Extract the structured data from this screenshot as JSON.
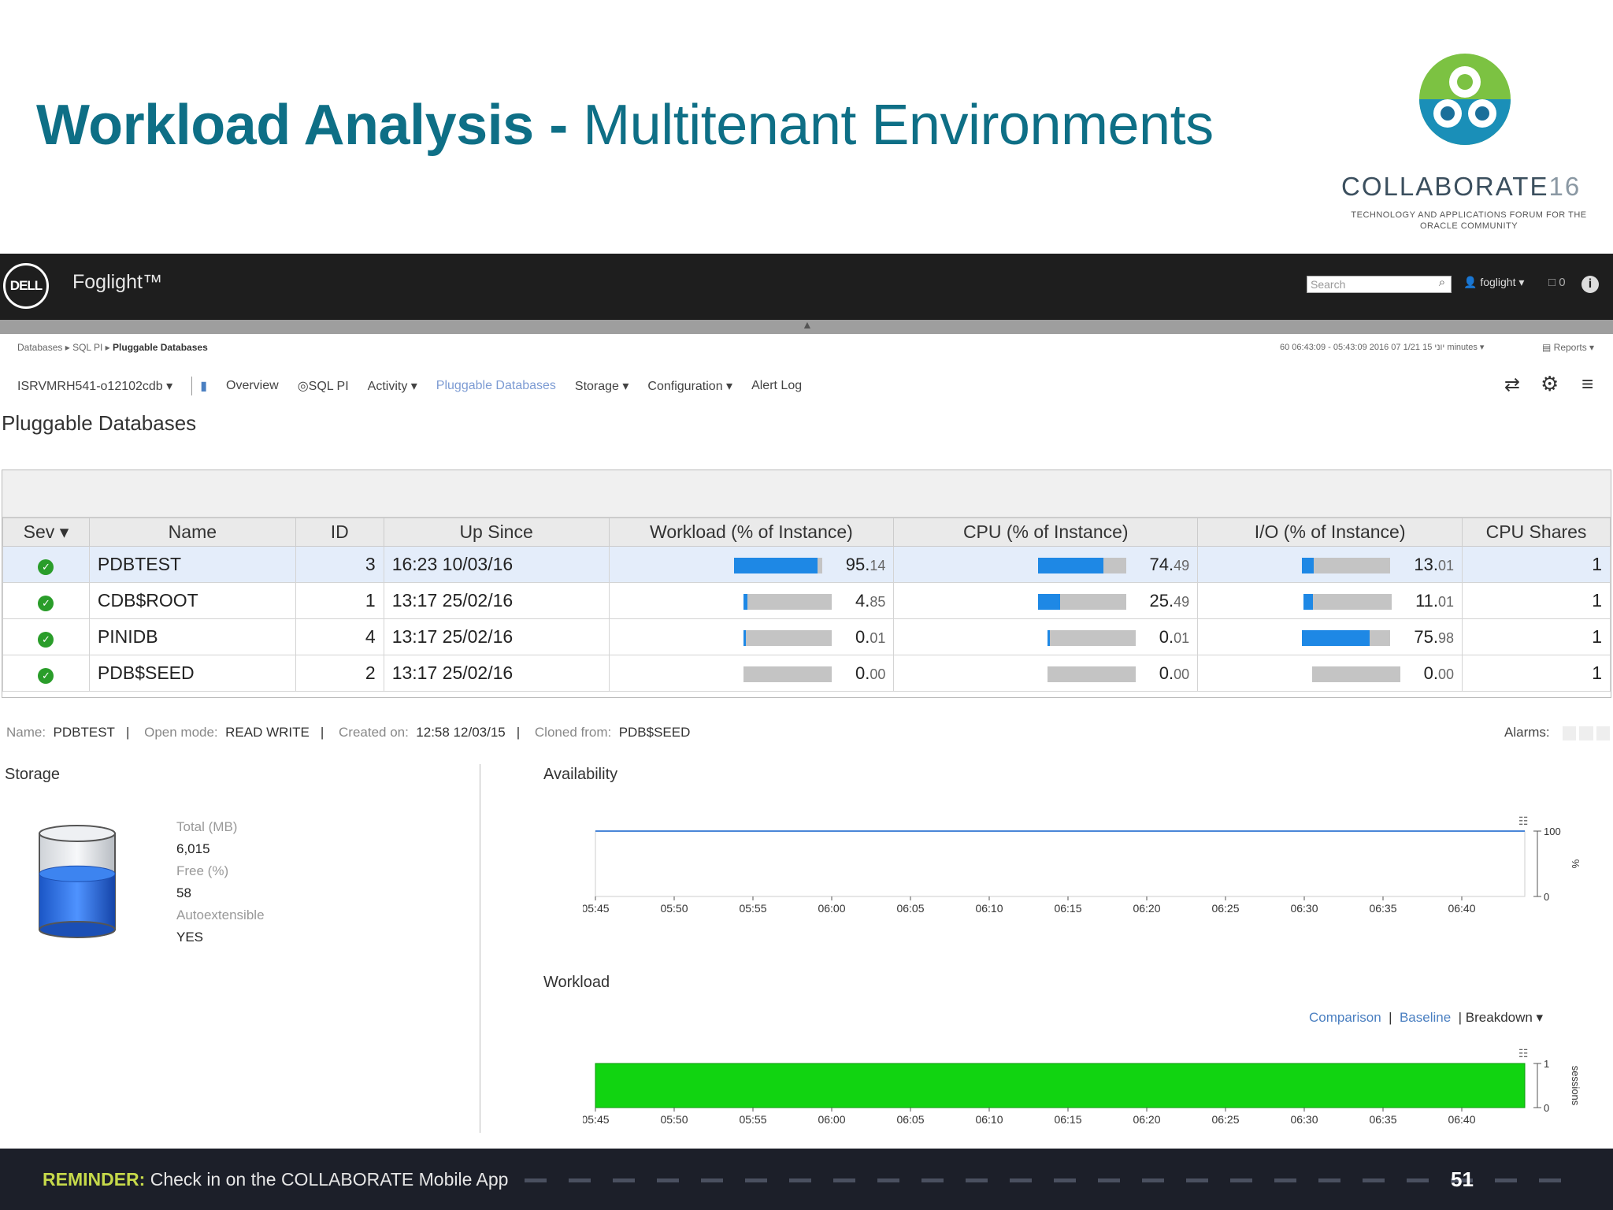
{
  "slide": {
    "title_bold": "Workload Analysis -",
    "title_rest": " Multitenant Environments",
    "logo_word": "COLLABORATE",
    "logo_year": "16",
    "logo_tagline": "TECHNOLOGY AND APPLICATIONS FORUM FOR THE ORACLE COMMUNITY",
    "reminder_label": "REMINDER:",
    "reminder_text": " Check in on the COLLABORATE Mobile App",
    "page_number": "51"
  },
  "app": {
    "vendor_logo": "DELL",
    "name": "Foglight™",
    "search_placeholder": "Search",
    "user": "foglight ▾",
    "chat": "□ 0",
    "info": "i"
  },
  "breadcrumb": {
    "root": "Databases",
    "mid": "SQL PI",
    "current": "Pluggable Databases"
  },
  "time_range": "60 06:43:09 - 05:43:09 2016 יוני 15 1/21 07 minutes ▾",
  "reports_label": "Reports ▾",
  "nav": {
    "instance": "ISRVMRH541-o12102cdb ▾",
    "items": [
      "Overview",
      "SQL PI",
      "Activity ▾",
      "Pluggable Databases",
      "Storage ▾",
      "Configuration ▾",
      "Alert Log"
    ],
    "active": "Pluggable Databases"
  },
  "page_title": "Pluggable Databases",
  "table": {
    "headers": [
      "Sev ▾",
      "Name",
      "ID",
      "Up Since",
      "Workload (% of Instance)",
      "CPU (% of Instance)",
      "I/O (% of Instance)",
      "CPU Shares"
    ],
    "rows": [
      {
        "name": "PDBTEST",
        "id": "3",
        "up_since": "16:23 10/03/16",
        "workload_int": "95.",
        "workload_dec": "14",
        "workload": 95.14,
        "cpu_int": "74.",
        "cpu_dec": "49",
        "cpu": 74.49,
        "io_int": "13.",
        "io_dec": "01",
        "io": 13.01,
        "cpu_shares": "1"
      },
      {
        "name": "CDB$ROOT",
        "id": "1",
        "up_since": "13:17 25/02/16",
        "workload_int": "4.",
        "workload_dec": "85",
        "workload": 4.85,
        "cpu_int": "25.",
        "cpu_dec": "49",
        "cpu": 25.49,
        "io_int": "11.",
        "io_dec": "01",
        "io": 11.01,
        "cpu_shares": "1"
      },
      {
        "name": "PINIDB",
        "id": "4",
        "up_since": "13:17 25/02/16",
        "workload_int": "0.",
        "workload_dec": "01",
        "workload": 0.01,
        "cpu_int": "0.",
        "cpu_dec": "01",
        "cpu": 0.01,
        "io_int": "75.",
        "io_dec": "98",
        "io": 75.98,
        "cpu_shares": "1"
      },
      {
        "name": "PDB$SEED",
        "id": "2",
        "up_since": "13:17 25/02/16",
        "workload_int": "0.",
        "workload_dec": "00",
        "workload": 0.0,
        "cpu_int": "0.",
        "cpu_dec": "00",
        "cpu": 0.0,
        "io_int": "0.",
        "io_dec": "00",
        "io": 0.0,
        "cpu_shares": "1"
      }
    ]
  },
  "info_bar": {
    "name_label": "Name:",
    "name": "PDBTEST",
    "open_label": "Open mode:",
    "open": "READ WRITE",
    "created_label": "Created on:",
    "created": "12:58 12/03/15",
    "cloned_label": "Cloned from:",
    "cloned": "PDB$SEED",
    "alarms_label": "Alarms:"
  },
  "storage": {
    "title": "Storage",
    "total_label": "Total (MB)",
    "total": "6,015",
    "free_label": "Free (%)",
    "free": "58",
    "auto_label": "Autoextensible",
    "auto": "YES",
    "fill_fraction": 0.58
  },
  "chart_data": [
    {
      "type": "line",
      "title": "Availability",
      "x": [
        "05:45",
        "05:50",
        "05:55",
        "06:00",
        "06:05",
        "06:10",
        "06:15",
        "06:20",
        "06:25",
        "06:30",
        "06:35",
        "06:40"
      ],
      "series": [
        {
          "values": [
            100,
            100,
            100,
            100,
            100,
            100,
            100,
            100,
            100,
            100,
            100,
            100
          ]
        }
      ],
      "ylabel": "%",
      "ylim": [
        0,
        100
      ],
      "y_ticks": [
        "100",
        "0"
      ]
    },
    {
      "type": "area",
      "title": "Workload",
      "x": [
        "05:45",
        "05:50",
        "05:55",
        "06:00",
        "06:05",
        "06:10",
        "06:15",
        "06:20",
        "06:25",
        "06:30",
        "06:35",
        "06:40"
      ],
      "series": [
        {
          "values": [
            1,
            1,
            1,
            1,
            1,
            1,
            1,
            1,
            1,
            1,
            1,
            1
          ]
        }
      ],
      "ylabel": "sessions",
      "ylim": [
        0,
        1
      ],
      "y_ticks": [
        "1",
        "0"
      ],
      "color": "#11d411"
    }
  ],
  "workload_links": {
    "comparison": "Comparison",
    "baseline": "Baseline",
    "breakdown": "Breakdown ▾"
  },
  "colors": {
    "title": "#0e6f86",
    "bar_fill": "#1e88e5",
    "bar_track": "#c4c4c4",
    "area": "#11d411"
  }
}
